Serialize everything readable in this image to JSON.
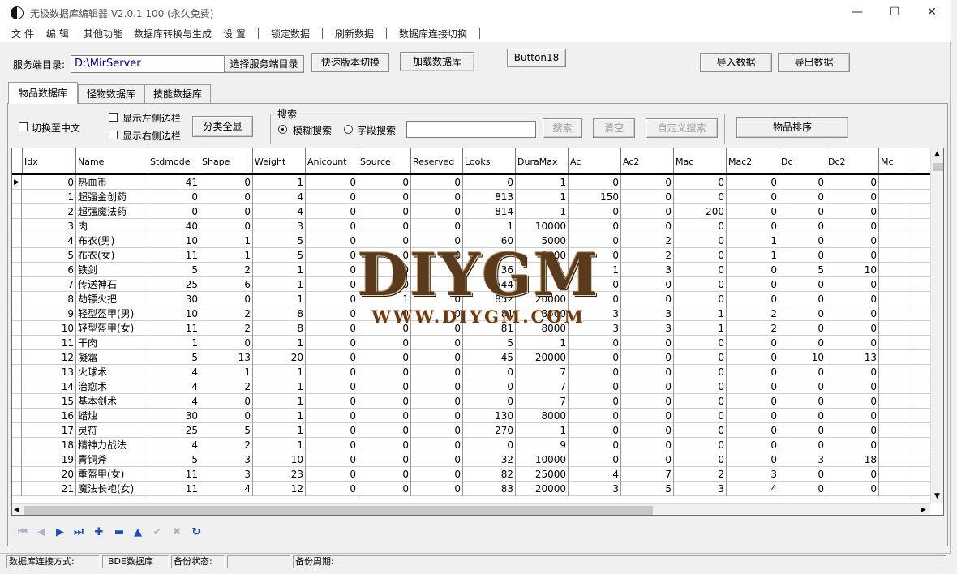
{
  "window": {
    "title": "无极数据库编辑器 V2.0.1.100 (永久免费)",
    "minimize_glyph": "—",
    "maximize_glyph": "☐",
    "close_glyph": "✕"
  },
  "menu": [
    "文 件",
    "编 辑",
    "其他功能",
    "数据库转换与生成",
    "设 置",
    "锁定数据",
    "刷新数据",
    "数据库连接切换"
  ],
  "toolbar": {
    "server_dir_label": "服务端目录:",
    "server_dir_value": "D:\\MirServer",
    "select_dir_button": "选择服务端目录",
    "quick_switch_button": "快速版本切换",
    "load_db_button": "加载数据库",
    "button18": "Button18",
    "import_button": "导入数据",
    "export_button": "导出数据"
  },
  "tabs": [
    "物品数据库",
    "怪物数据库",
    "技能数据库"
  ],
  "options": {
    "switch_chinese": "切换至中文",
    "show_left_sidebar": "显示左侧边栏",
    "show_right_sidebar": "显示右侧边栏",
    "show_all_categories": "分类全显"
  },
  "search": {
    "group_title": "搜索",
    "fuzzy_label": "模糊搜索",
    "field_label": "字段搜索",
    "value": "",
    "search_button": "搜索",
    "clear_button": "清空",
    "custom_button": "自定义搜索"
  },
  "sort_button": "物品排序",
  "grid": {
    "columns": [
      "Idx",
      "Name",
      "Stdmode",
      "Shape",
      "Weight",
      "Anicount",
      "Source",
      "Reserved",
      "Looks",
      "DuraMax",
      "Ac",
      "Ac2",
      "Mac",
      "Mac2",
      "Dc",
      "Dc2",
      "Mc"
    ],
    "rows": [
      [
        "0",
        "热血币",
        "41",
        "0",
        "1",
        "0",
        "0",
        "0",
        "0",
        "1",
        "0",
        "0",
        "0",
        "0",
        "0",
        "0",
        ""
      ],
      [
        "1",
        "超强金创药",
        "0",
        "0",
        "4",
        "0",
        "0",
        "0",
        "813",
        "1",
        "150",
        "0",
        "0",
        "0",
        "0",
        "0",
        ""
      ],
      [
        "2",
        "超强魔法药",
        "0",
        "0",
        "4",
        "0",
        "0",
        "0",
        "814",
        "1",
        "0",
        "0",
        "200",
        "0",
        "0",
        "0",
        ""
      ],
      [
        "3",
        "肉",
        "40",
        "0",
        "3",
        "0",
        "0",
        "0",
        "1",
        "10000",
        "0",
        "0",
        "0",
        "0",
        "0",
        "0",
        ""
      ],
      [
        "4",
        "布衣(男)",
        "10",
        "1",
        "5",
        "0",
        "0",
        "0",
        "60",
        "5000",
        "0",
        "2",
        "0",
        "1",
        "0",
        "0",
        ""
      ],
      [
        "5",
        "布衣(女)",
        "11",
        "1",
        "5",
        "0",
        "0",
        "0",
        "",
        "5000",
        "0",
        "2",
        "0",
        "1",
        "0",
        "0",
        ""
      ],
      [
        "6",
        "铁剑",
        "5",
        "2",
        "1",
        "0",
        "0",
        "0",
        "36",
        "",
        "1",
        "3",
        "0",
        "0",
        "5",
        "10",
        ""
      ],
      [
        "7",
        "传送神石",
        "25",
        "6",
        "1",
        "0",
        "0",
        "0",
        "644",
        "",
        "0",
        "0",
        "0",
        "0",
        "0",
        "0",
        ""
      ],
      [
        "8",
        "劫镖火把",
        "30",
        "0",
        "1",
        "0",
        "1",
        "0",
        "852",
        "20000",
        "0",
        "0",
        "0",
        "0",
        "0",
        "0",
        ""
      ],
      [
        "9",
        "轻型盔甲(男)",
        "10",
        "2",
        "8",
        "0",
        "0",
        "0",
        "81",
        "8000",
        "3",
        "3",
        "1",
        "2",
        "0",
        "0",
        ""
      ],
      [
        "10",
        "轻型盔甲(女)",
        "11",
        "2",
        "8",
        "0",
        "0",
        "0",
        "81",
        "8000",
        "3",
        "3",
        "1",
        "2",
        "0",
        "0",
        ""
      ],
      [
        "11",
        "干肉",
        "1",
        "0",
        "1",
        "0",
        "0",
        "0",
        "5",
        "1",
        "0",
        "0",
        "0",
        "0",
        "0",
        "0",
        ""
      ],
      [
        "12",
        "凝霜",
        "5",
        "13",
        "20",
        "0",
        "0",
        "0",
        "45",
        "20000",
        "0",
        "0",
        "0",
        "0",
        "10",
        "13",
        ""
      ],
      [
        "13",
        "火球术",
        "4",
        "1",
        "1",
        "0",
        "0",
        "0",
        "0",
        "7",
        "0",
        "0",
        "0",
        "0",
        "0",
        "0",
        ""
      ],
      [
        "14",
        "治愈术",
        "4",
        "2",
        "1",
        "0",
        "0",
        "0",
        "0",
        "7",
        "0",
        "0",
        "0",
        "0",
        "0",
        "0",
        ""
      ],
      [
        "15",
        "基本剑术",
        "4",
        "0",
        "1",
        "0",
        "0",
        "0",
        "0",
        "7",
        "0",
        "0",
        "0",
        "0",
        "0",
        "0",
        ""
      ],
      [
        "16",
        "蜡烛",
        "30",
        "0",
        "1",
        "0",
        "0",
        "0",
        "130",
        "8000",
        "0",
        "0",
        "0",
        "0",
        "0",
        "0",
        ""
      ],
      [
        "17",
        "灵符",
        "25",
        "5",
        "1",
        "0",
        "0",
        "0",
        "270",
        "1",
        "0",
        "0",
        "0",
        "0",
        "0",
        "0",
        ""
      ],
      [
        "18",
        "精神力战法",
        "4",
        "2",
        "1",
        "0",
        "0",
        "0",
        "0",
        "9",
        "0",
        "0",
        "0",
        "0",
        "0",
        "0",
        ""
      ],
      [
        "19",
        "青铜斧",
        "5",
        "3",
        "10",
        "0",
        "0",
        "0",
        "32",
        "10000",
        "0",
        "0",
        "0",
        "0",
        "3",
        "18",
        ""
      ],
      [
        "20",
        "重盔甲(女)",
        "11",
        "3",
        "23",
        "0",
        "0",
        "0",
        "82",
        "25000",
        "4",
        "7",
        "2",
        "3",
        "0",
        "0",
        ""
      ],
      [
        "21",
        "魔法长袍(女)",
        "11",
        "4",
        "12",
        "0",
        "0",
        "0",
        "83",
        "20000",
        "3",
        "5",
        "3",
        "4",
        "0",
        "0",
        ""
      ]
    ]
  },
  "navigator": [
    {
      "icon": "first-record-icon",
      "glyph": "⏮",
      "color": "#a8b4c8"
    },
    {
      "icon": "prior-record-icon",
      "glyph": "◀",
      "color": "#a8b4c8"
    },
    {
      "icon": "next-record-icon",
      "glyph": "▶",
      "color": "#1f4fbf"
    },
    {
      "icon": "last-record-icon",
      "glyph": "⏭",
      "color": "#1f4fbf"
    },
    {
      "icon": "insert-record-icon",
      "glyph": "✚",
      "color": "#1f4fbf"
    },
    {
      "icon": "delete-record-icon",
      "glyph": "▬",
      "color": "#1f4fbf"
    },
    {
      "icon": "edit-record-icon",
      "glyph": "▲",
      "color": "#1f4fbf"
    },
    {
      "icon": "post-edit-icon",
      "glyph": "✔",
      "color": "#a8b4c8"
    },
    {
      "icon": "cancel-edit-icon",
      "glyph": "✖",
      "color": "#a8b4c8"
    },
    {
      "icon": "refresh-data-icon",
      "glyph": "↻",
      "color": "#1f4fbf"
    }
  ],
  "status": {
    "conn_label": "数据库连接方式:",
    "conn_value": "BDE数据库",
    "backup_state_label": "备份状态:",
    "backup_state_value": "",
    "backup_cycle_label": "备份周期:"
  },
  "watermark": {
    "logo_text": "DIYGM",
    "url_text": "WWW.DIYGM.COM"
  },
  "colors": {
    "path_text": "#00008b",
    "nav_active": "#1f4fbf",
    "nav_inactive": "#a8b4c8"
  }
}
